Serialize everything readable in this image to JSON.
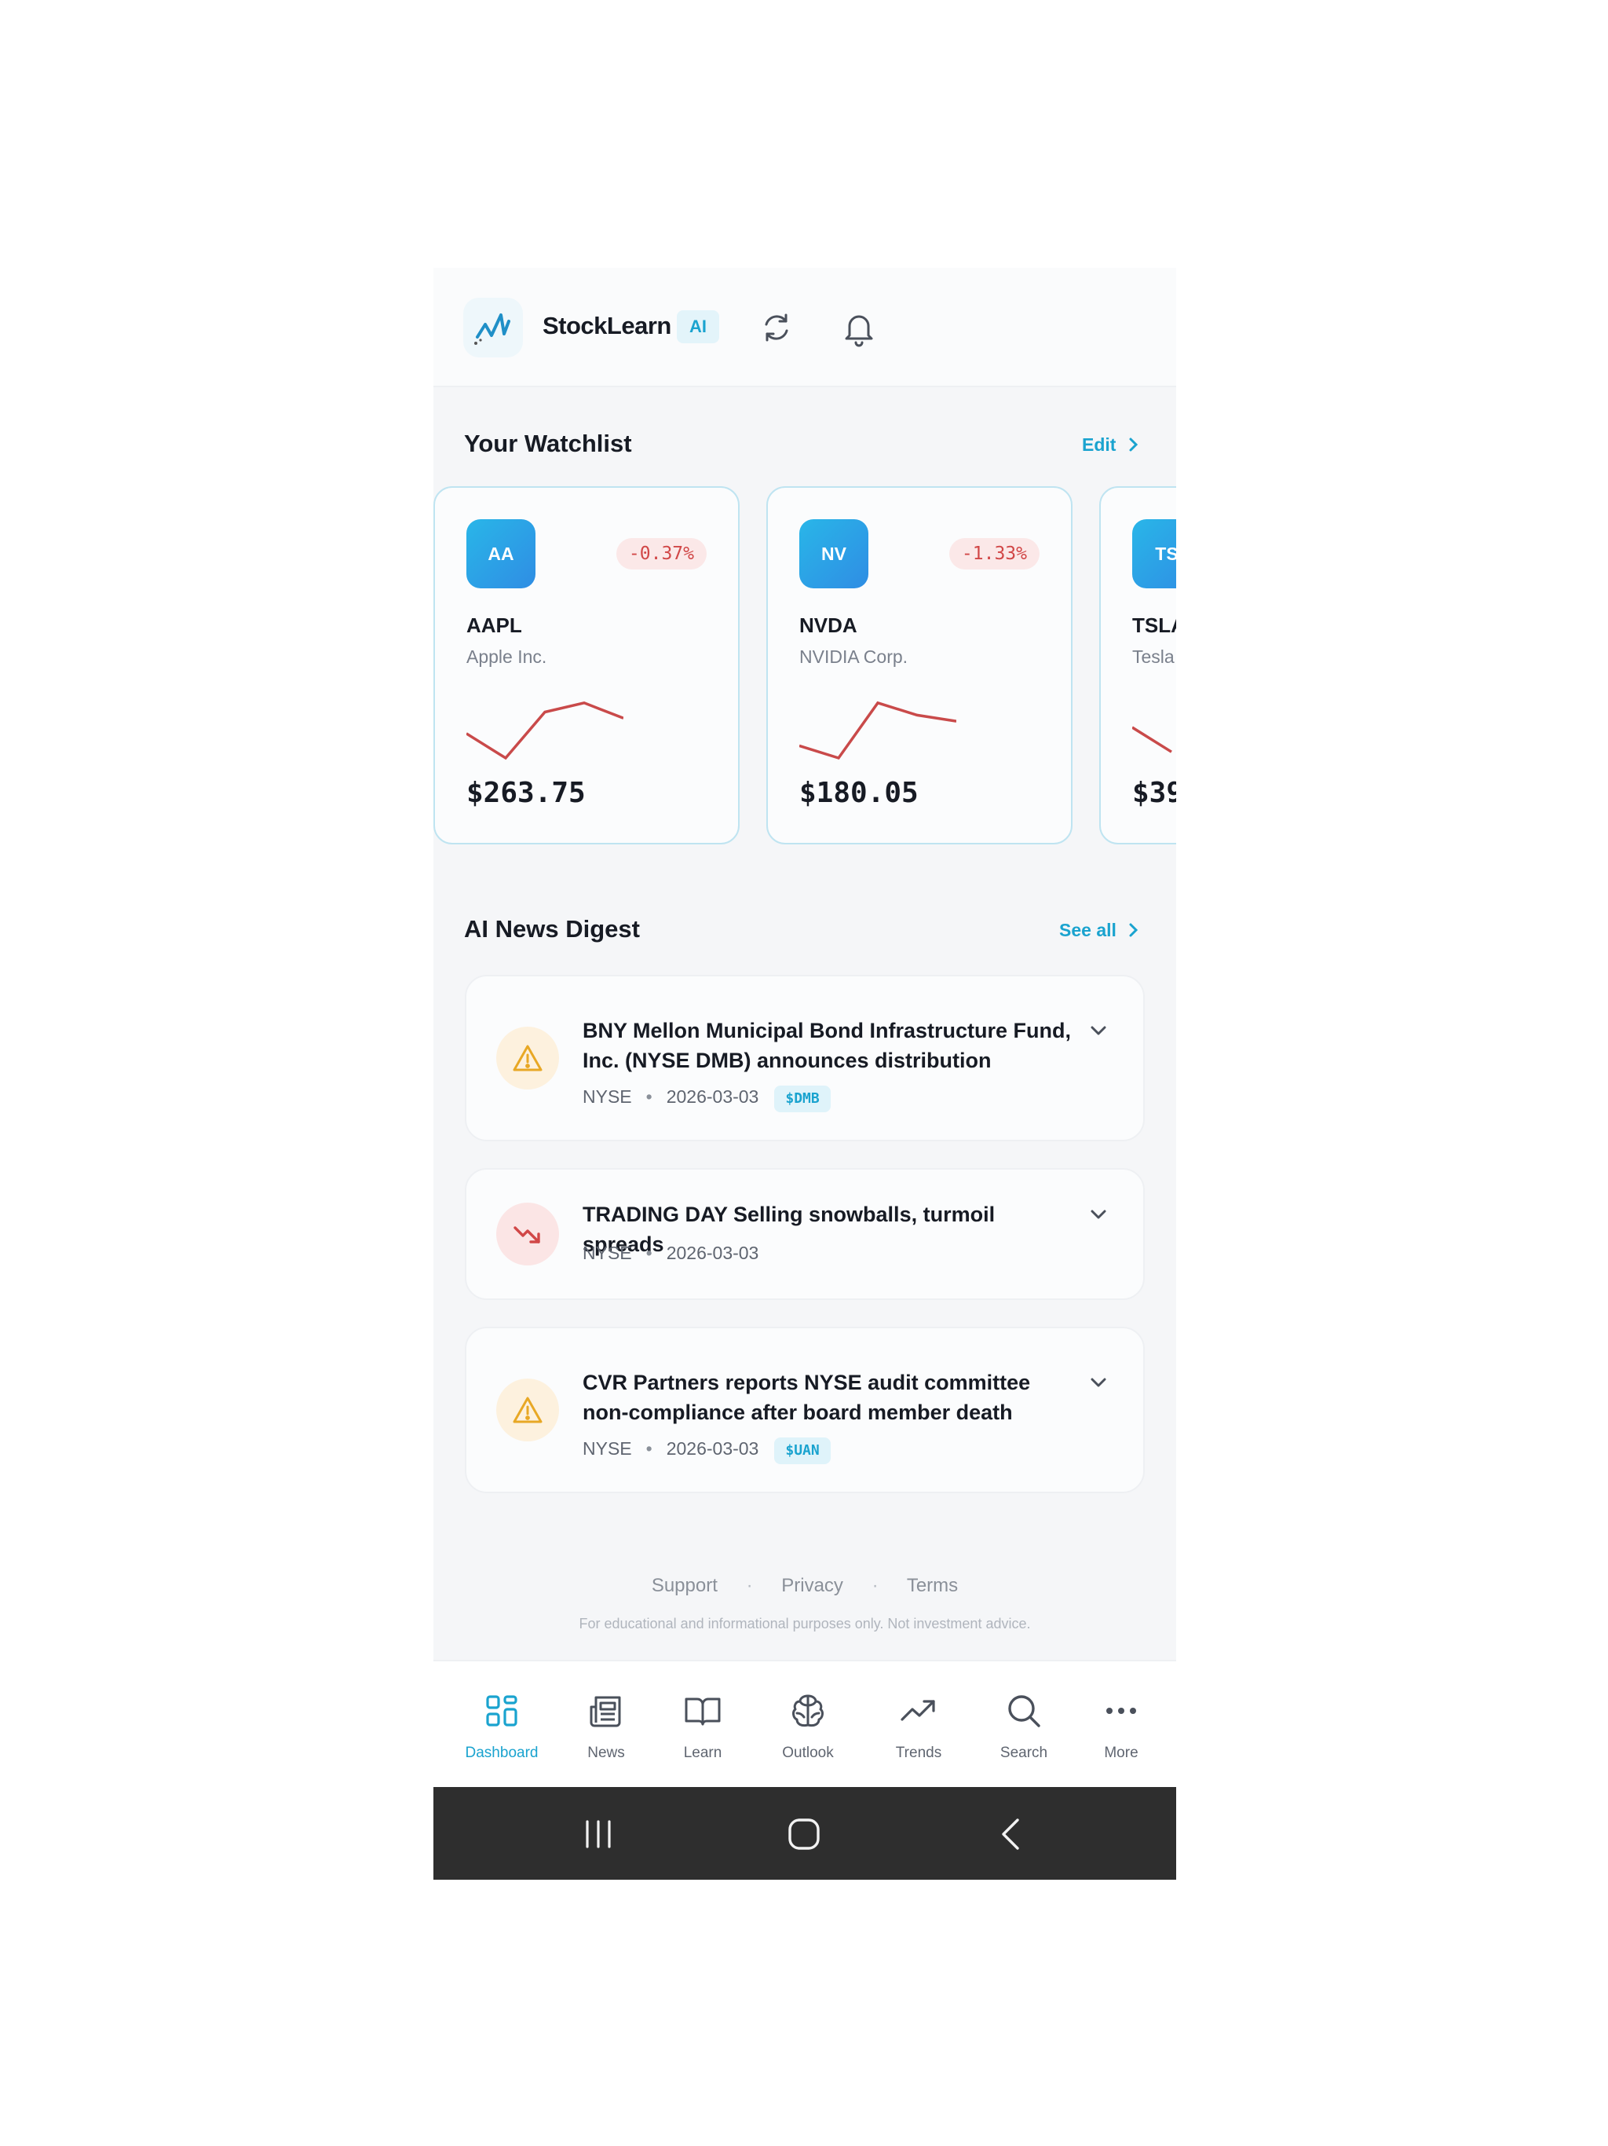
{
  "header": {
    "app_title": "StockLearn",
    "ai_badge": "AI",
    "icons": [
      "refresh-icon",
      "bell-icon"
    ]
  },
  "watchlist": {
    "title": "Your Watchlist",
    "edit_label": "Edit",
    "cards": [
      {
        "initials": "AA",
        "ticker": "AAPL",
        "company": "Apple Inc.",
        "change": "-0.37%",
        "price": "$263.75",
        "spark": [
          0.4,
          0.0,
          0.75,
          0.9,
          0.65
        ]
      },
      {
        "initials": "NV",
        "ticker": "NVDA",
        "company": "NVIDIA Corp.",
        "change": "-1.33%",
        "price": "$180.05",
        "spark": [
          0.2,
          0.0,
          0.9,
          0.7,
          0.6
        ]
      },
      {
        "initials": "TS",
        "ticker": "TSLA",
        "company": "Tesla",
        "change": "",
        "price": "$39",
        "spark": [
          0.5,
          0.1
        ]
      }
    ],
    "trend_color": "#c94a4a"
  },
  "news": {
    "title": "AI News Digest",
    "see_all_label": "See all",
    "items": [
      {
        "icon": "warning-icon",
        "title": "BNY Mellon Municipal Bond Infrastructure Fund, Inc. (NYSE DMB) announces distribution",
        "exchange": "NYSE",
        "date": "2026-03-03",
        "tag": "$DMB"
      },
      {
        "icon": "trending-down-icon",
        "title": "TRADING DAY Selling snowballs, turmoil spreads",
        "exchange": "NYSE",
        "date": "2026-03-03",
        "tag": ""
      },
      {
        "icon": "warning-icon",
        "title": "CVR Partners reports NYSE audit committee non-compliance after board member death",
        "exchange": "NYSE",
        "date": "2026-03-03",
        "tag": "$UAN"
      }
    ],
    "meta_separator": "•"
  },
  "footer": {
    "links": [
      "Support",
      "Privacy",
      "Terms"
    ],
    "separator": "·",
    "disclaimer": "For educational and informational purposes only. Not investment advice."
  },
  "bottom_nav": {
    "items": [
      {
        "label": "Dashboard",
        "icon": "dashboard-icon",
        "active": true
      },
      {
        "label": "News",
        "icon": "newspaper-icon",
        "active": false
      },
      {
        "label": "Learn",
        "icon": "book-icon",
        "active": false
      },
      {
        "label": "Outlook",
        "icon": "brain-icon",
        "active": false
      },
      {
        "label": "Trends",
        "icon": "trending-up-icon",
        "active": false
      },
      {
        "label": "Search",
        "icon": "search-icon",
        "active": false
      },
      {
        "label": "More",
        "icon": "more-icon",
        "active": false
      }
    ]
  },
  "colors": {
    "accent": "#1aa3cf",
    "negative": "#d14747",
    "warning": "#e8a825"
  }
}
